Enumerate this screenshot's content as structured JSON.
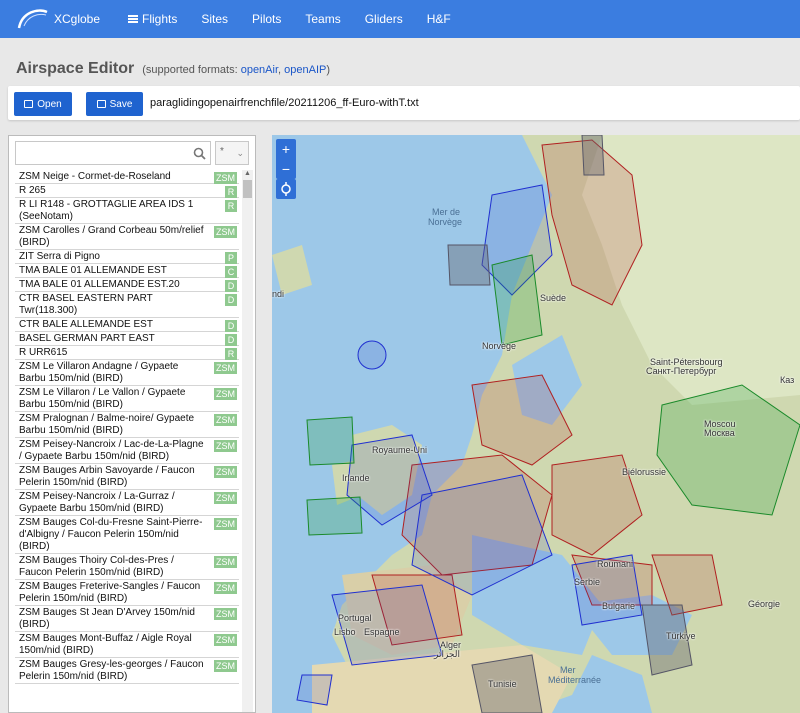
{
  "nav": {
    "brand": "XCglobe",
    "items": [
      "Flights",
      "Sites",
      "Pilots",
      "Teams",
      "Gliders",
      "H&F"
    ]
  },
  "page": {
    "title": "Airspace Editor",
    "formats_prefix": "(supported formats: ",
    "format_openair": "openAir",
    "format_sep": ", ",
    "format_openaip": "openAIP",
    "formats_suffix": ")"
  },
  "toolbar": {
    "open_label": "Open",
    "save_label": "Save",
    "filename": "paraglidingopenairfrenchfile/20211206_ff-Euro-withT.txt"
  },
  "filter": {
    "search_value": "",
    "type_value": "*"
  },
  "airspaces": [
    {
      "name": "ZSM Neige - Cormet-de-Roseland",
      "cls": "ZSM"
    },
    {
      "name": "R 265",
      "cls": "R"
    },
    {
      "name": "R LI R148 - GROTTAGLIE AREA IDS 1 (SeeNotam)",
      "cls": "R"
    },
    {
      "name": "ZSM Carolles / Grand Corbeau 50m/relief (BIRD)",
      "cls": "ZSM"
    },
    {
      "name": "ZIT Serra di Pigno",
      "cls": "P"
    },
    {
      "name": "TMA BALE 01 ALLEMANDE EST",
      "cls": "C"
    },
    {
      "name": "TMA BALE 01 ALLEMANDE EST.20",
      "cls": "D"
    },
    {
      "name": "CTR BASEL EASTERN PART Twr(118.300)",
      "cls": "D"
    },
    {
      "name": "CTR BALE ALLEMANDE EST",
      "cls": "D"
    },
    {
      "name": "BASEL GERMAN PART EAST",
      "cls": "D"
    },
    {
      "name": "R URR615",
      "cls": "R"
    },
    {
      "name": "ZSM Le Villaron Andagne / Gypaete Barbu 150m/nid (BIRD)",
      "cls": "ZSM"
    },
    {
      "name": "ZSM Le Villaron / Le Vallon / Gypaete Barbu 150m/nid (BIRD)",
      "cls": "ZSM"
    },
    {
      "name": "ZSM Pralognan / Balme-noire/ Gypaete Barbu 150m/nid (BIRD)",
      "cls": "ZSM"
    },
    {
      "name": "ZSM Peisey-Nancroix / Lac-de-La-Plagne / Gypaete Barbu 150m/nid (BIRD)",
      "cls": "ZSM"
    },
    {
      "name": "ZSM Bauges Arbin Savoyarde / Faucon Pelerin 150m/nid (BIRD)",
      "cls": "ZSM"
    },
    {
      "name": "ZSM Peisey-Nancroix / La-Gurraz / Gypaete Barbu 150m/nid (BIRD)",
      "cls": "ZSM"
    },
    {
      "name": "ZSM Bauges Col-du-Fresne Saint-Pierre-d'Albigny / Faucon Pelerin 150m/nid (BIRD)",
      "cls": "ZSM"
    },
    {
      "name": "ZSM Bauges Thoiry Col-des-Pres / Faucon Pelerin 150m/nid (BIRD)",
      "cls": "ZSM"
    },
    {
      "name": "ZSM Bauges Freterive-Sangles / Faucon Pelerin 150m/nid (BIRD)",
      "cls": "ZSM"
    },
    {
      "name": "ZSM Bauges St Jean D'Arvey 150m/nid (BIRD)",
      "cls": "ZSM"
    },
    {
      "name": "ZSM Bauges Mont-Buffaz / Aigle Royal 150m/nid (BIRD)",
      "cls": "ZSM"
    },
    {
      "name": "ZSM Bauges Gresy-les-georges / Faucon Pelerin 150m/nid (BIRD)",
      "cls": "ZSM"
    }
  ],
  "map": {
    "zoom_in": "+",
    "zoom_out": "−",
    "labels": {
      "mer_norvege_1": "Mer de",
      "mer_norvege_2": "Norvège",
      "suede": "Suède",
      "norvege": "Norvège",
      "st_petersbourg_1": "Saint-Pétersbourg",
      "st_petersbourg_2": "Санкт-Петербург",
      "moscou_1": "Moscou",
      "moscou_2": "Москва",
      "royaume_uni": "Royaume-Uni",
      "irlande": "Irlande",
      "bielorussie": "Biélorussie",
      "roumanie": "Roumani",
      "serbie": "Serbie",
      "bulgarie": "Bulgarie",
      "georgie": "Géorgie",
      "turkiye": "Türkiye",
      "tunisie": "Tunisie",
      "mediterranee_1": "Mer",
      "mediterranee_2": "Méditerranée",
      "espagne": "Espagne",
      "portugal": "Portugal",
      "lisbonne": "Lisbo",
      "alger_1": "Alger",
      "alger_2": "الجزائر",
      "kazan": "Каз",
      "iceland": "ndi"
    }
  }
}
